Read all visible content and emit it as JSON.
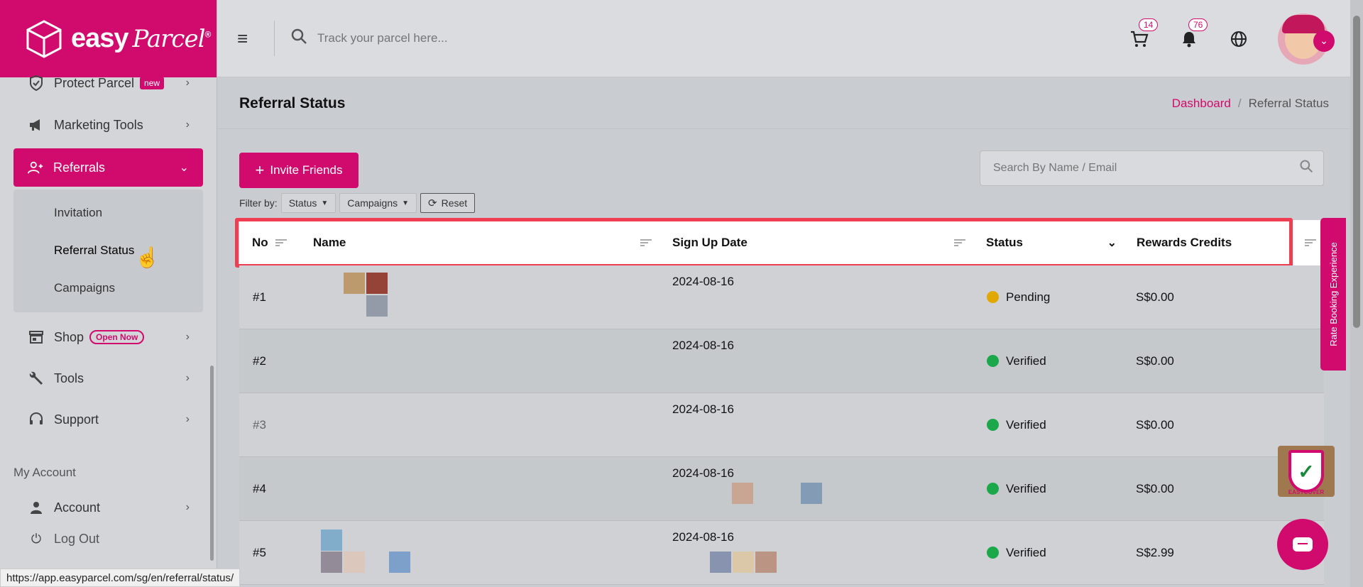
{
  "brand": {
    "name": "easy",
    "script": "Parcel",
    "mark": "®",
    "color": "#d10a6e"
  },
  "topbar": {
    "search_placeholder": "Track your parcel here...",
    "cart_count": "14",
    "notif_count": "76"
  },
  "sidebar": {
    "items": [
      {
        "label": "Protect Parcel",
        "badge": "new"
      },
      {
        "label": "Marketing Tools"
      },
      {
        "label": "Referrals"
      },
      {
        "label": "Shop",
        "badge": "Open Now"
      },
      {
        "label": "Tools"
      },
      {
        "label": "Support"
      }
    ],
    "sub_items": [
      "Invitation",
      "Referral Status",
      "Campaigns"
    ],
    "section": "My Account",
    "account": "Account",
    "logout": "Log Out"
  },
  "page": {
    "title": "Referral Status",
    "breadcrumb": [
      "Dashboard",
      "Referral Status"
    ]
  },
  "controls": {
    "invite_label": "Invite Friends",
    "search_placeholder": "Search By Name / Email",
    "filter_by": "Filter by:",
    "filters": [
      "Status",
      "Campaigns"
    ],
    "reset": "Reset"
  },
  "table": {
    "columns": [
      "No",
      "Name",
      "Sign Up Date",
      "Status",
      "Rewards Credits"
    ],
    "rows": [
      {
        "no": "#1",
        "date": "2024-08-16",
        "status": "Pending",
        "status_color": "#e0a800",
        "credits": "S$0.00"
      },
      {
        "no": "#2",
        "date": "2024-08-16",
        "status": "Verified",
        "status_color": "#1aa84a",
        "credits": "S$0.00"
      },
      {
        "no": "#3",
        "date": "2024-08-16",
        "status": "Verified",
        "status_color": "#1aa84a",
        "credits": "S$0.00"
      },
      {
        "no": "#4",
        "date": "2024-08-16",
        "status": "Verified",
        "status_color": "#1aa84a",
        "credits": "S$0.00"
      },
      {
        "no": "#5",
        "date": "2024-08-16",
        "status": "Verified",
        "status_color": "#1aa84a",
        "credits": "S$2.99"
      }
    ]
  },
  "widgets": {
    "rate_tab": "Rate Booking Experience",
    "easycover": "EASYCOVER"
  },
  "status_url": "https://app.easyparcel.com/sg/en/referral/status/"
}
